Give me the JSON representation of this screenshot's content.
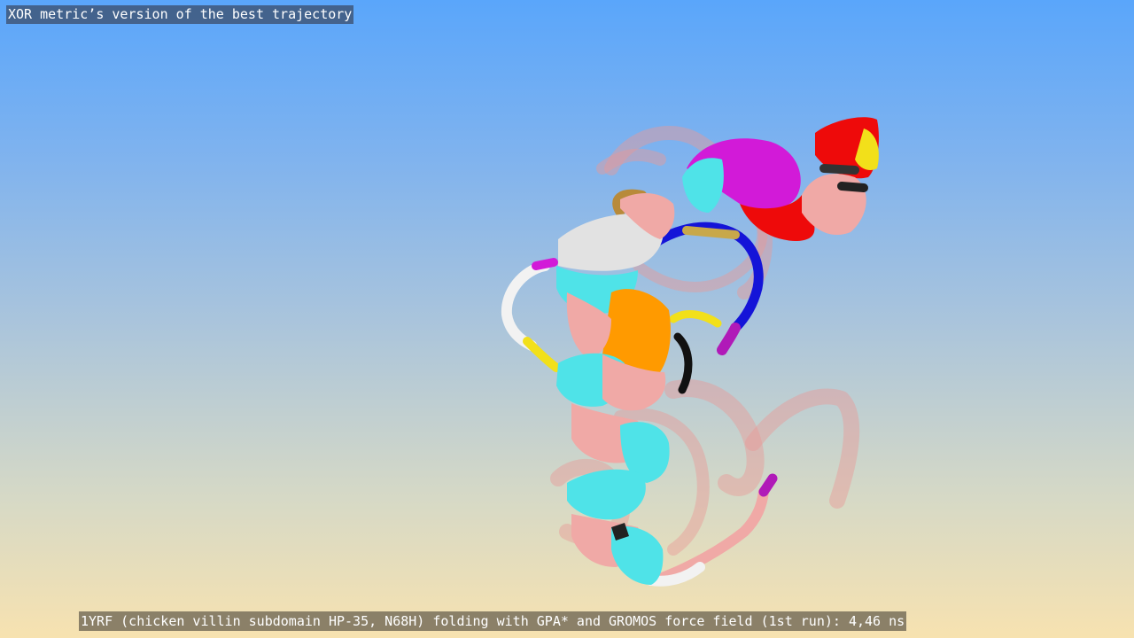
{
  "video": {
    "top_caption": "XOR metric’s version of the best trajectory",
    "bottom_caption": "1YRF (chicken villin subdomain HP-35, N68H) folding with GPA* and GROMOS force field (1st run): 4,46 ns"
  },
  "colors": {
    "background_top": "#5aa6fb",
    "background_bottom": "#f7e2b0",
    "helix_cyan": "#4fe3e8",
    "helix_pink": "#f0a9a6",
    "helix_red": "#ee0a0a",
    "helix_magenta": "#d21ad8",
    "helix_orange": "#ff9a00",
    "coil_blue": "#1414d8",
    "coil_yellow": "#f2e01a",
    "coil_white": "#f2f2f2",
    "ghost_pink": "#e89a96"
  }
}
